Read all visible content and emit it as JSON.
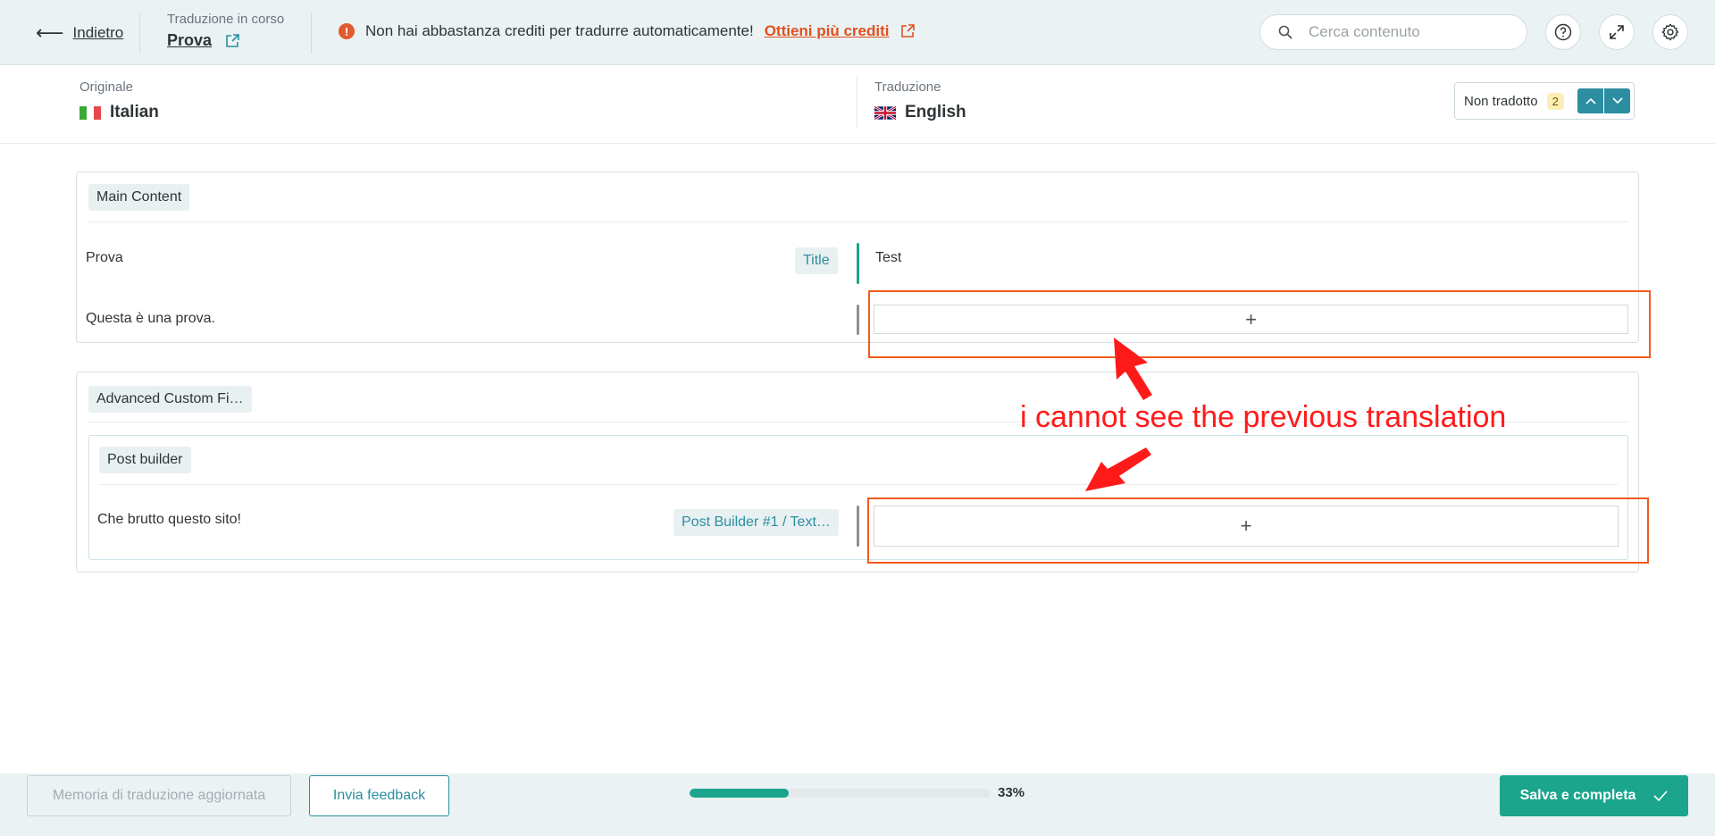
{
  "header": {
    "back_label": "Indietro",
    "status_label": "Traduzione in corso",
    "document_name": "Prova",
    "warning_text": "Non hai abbastanza crediti per tradurre automaticamente!",
    "warning_link": "Ottieni più crediti",
    "search_placeholder": "Cerca contenuto"
  },
  "languages": {
    "source_label": "Originale",
    "source_language": "Italian",
    "target_label": "Traduzione",
    "target_language": "English",
    "untranslated_label": "Non tradotto",
    "untranslated_count": "2"
  },
  "sections": {
    "main": {
      "title": "Main Content",
      "rows": [
        {
          "source": "Prova",
          "tag": "Title",
          "target": "Test"
        },
        {
          "source": "Questa è una prova.",
          "tag": "",
          "target": ""
        }
      ]
    },
    "acf": {
      "title": "Advanced Custom Fi…",
      "subsection": {
        "title": "Post builder",
        "rows": [
          {
            "source": "Che brutto questo sito!",
            "tag": "Post Builder #1 / Text…",
            "target": ""
          }
        ]
      }
    }
  },
  "annotation": {
    "text": "i cannot see the previous translation",
    "color": "#ff1a1a"
  },
  "footer": {
    "memory_button": "Memoria di traduzione aggiornata",
    "feedback_button": "Invia feedback",
    "progress_percent": 33,
    "progress_text": "33%",
    "save_button": "Salva e completa"
  },
  "colors": {
    "accent": "#2c8ea0",
    "success": "#1aa58c",
    "warning": "#e25b2e",
    "annotation_box": "#f05a1f"
  },
  "icons": [
    "back-arrow-icon",
    "external-link-icon",
    "warning-icon",
    "search-icon",
    "help-icon",
    "expand-icon",
    "settings-icon",
    "italy-flag-icon",
    "uk-flag-icon",
    "chevron-up-icon",
    "chevron-down-icon",
    "plus-icon",
    "check-icon"
  ]
}
